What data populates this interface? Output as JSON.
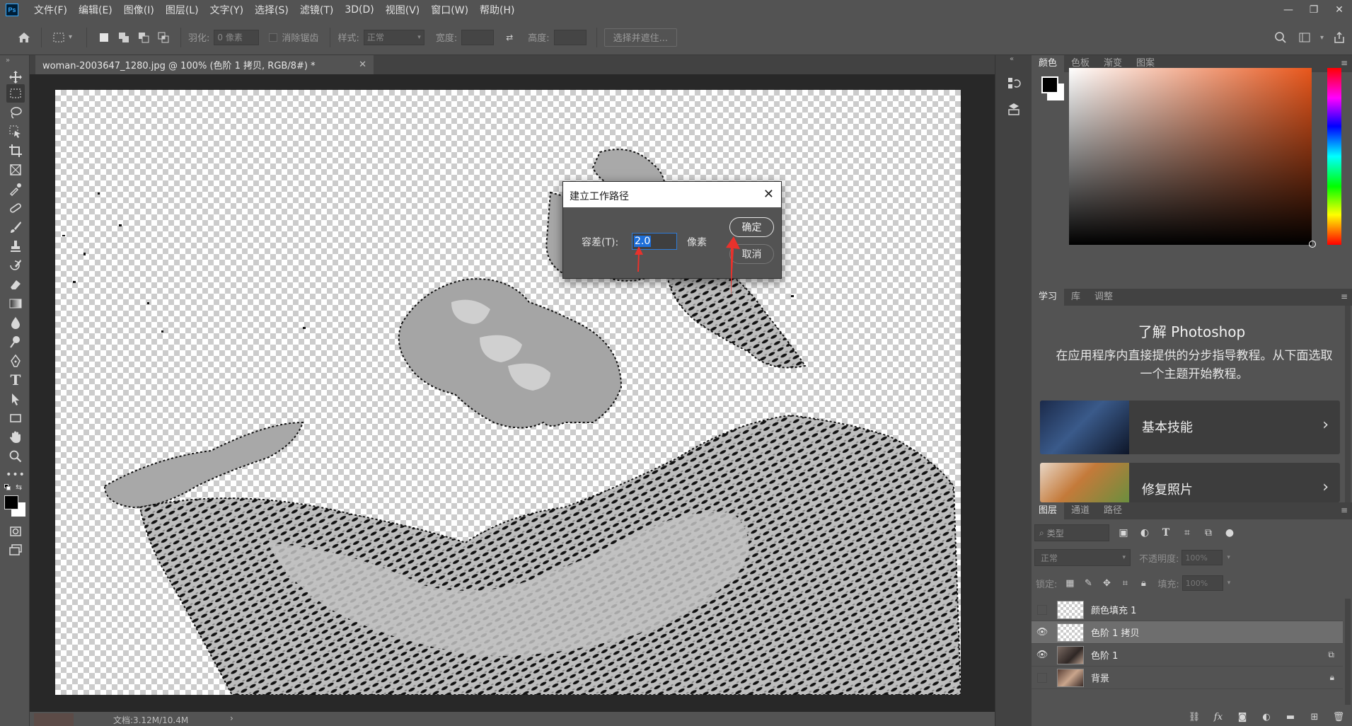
{
  "menubar": {
    "logo": "Ps",
    "items": [
      "文件(F)",
      "编辑(E)",
      "图像(I)",
      "图层(L)",
      "文字(Y)",
      "选择(S)",
      "滤镜(T)",
      "3D(D)",
      "视图(V)",
      "窗口(W)",
      "帮助(H)"
    ]
  },
  "options": {
    "feather_label": "羽化:",
    "feather_value": "0 像素",
    "antialias_label": "消除锯齿",
    "style_label": "样式:",
    "style_value": "正常",
    "width_label": "宽度:",
    "height_label": "高度:",
    "select_mask_button": "选择并遮住..."
  },
  "document": {
    "tab_title": "woman-2003647_1280.jpg @ 100% (色阶 1 拷贝, RGB/8#) *",
    "status": "文档:3.12M/10.4M"
  },
  "color_panel": {
    "tabs": [
      "颜色",
      "色板",
      "渐变",
      "图案"
    ],
    "foreground": "#000000",
    "background": "#ffffff",
    "hue_base": "#e8561b"
  },
  "learn_panel": {
    "tabs": [
      "学习",
      "库",
      "调整"
    ],
    "title": "了解 Photoshop",
    "description": "在应用程序内直接提供的分步指导教程。从下面选取一个主题开始教程。",
    "cards": [
      "基本技能",
      "修复照片"
    ]
  },
  "layers_panel": {
    "tabs": [
      "图层",
      "通道",
      "路径"
    ],
    "filter_placeholder": "类型",
    "blend_mode": "正常",
    "opacity_label": "不透明度:",
    "opacity_value": "100%",
    "lock_label": "锁定:",
    "fill_label": "填充:",
    "fill_value": "100%",
    "layers": [
      {
        "name": "颜色填充 1",
        "visible": false,
        "selected": false
      },
      {
        "name": "色阶 1 拷贝",
        "visible": true,
        "selected": true
      },
      {
        "name": "色阶 1",
        "visible": true,
        "selected": false
      },
      {
        "name": "背景",
        "visible": false,
        "selected": false
      }
    ]
  },
  "dialog": {
    "title": "建立工作路径",
    "tolerance_label": "容差(T):",
    "tolerance_value": "2.0",
    "unit": "像素",
    "ok": "确定",
    "cancel": "取消"
  },
  "colors": {
    "annotation_arrow": "#e8322c",
    "selection_blue": "#1e6fd9"
  }
}
